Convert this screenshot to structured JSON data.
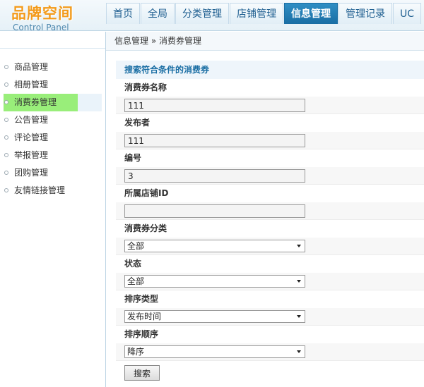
{
  "logo": {
    "title": "品牌空间",
    "subtitle": "Control Panel"
  },
  "nav": {
    "tabs": [
      {
        "label": "首页"
      },
      {
        "label": "全局"
      },
      {
        "label": "分类管理"
      },
      {
        "label": "店铺管理"
      },
      {
        "label": "信息管理",
        "active": true
      },
      {
        "label": "管理记录"
      },
      {
        "label": "UC"
      }
    ]
  },
  "sidebar": {
    "items": [
      {
        "label": "商品管理"
      },
      {
        "label": "相册管理"
      },
      {
        "label": "消费券管理",
        "active": true
      },
      {
        "label": "公告管理"
      },
      {
        "label": "评论管理"
      },
      {
        "label": "举报管理"
      },
      {
        "label": "团购管理"
      },
      {
        "label": "友情链接管理"
      }
    ]
  },
  "breadcrumb": {
    "parent": "信息管理",
    "separator": "»",
    "current": "消费券管理"
  },
  "search": {
    "title": "搜索符合条件的消费券",
    "fields": {
      "name": {
        "label": "消费券名称",
        "value": "111"
      },
      "publisher": {
        "label": "发布者",
        "value": "111"
      },
      "number": {
        "label": "编号",
        "value": "3"
      },
      "shop_id": {
        "label": "所属店铺ID",
        "value": ""
      },
      "category": {
        "label": "消费券分类",
        "selected": "全部"
      },
      "status": {
        "label": "状态",
        "selected": "全部"
      },
      "sort_type": {
        "label": "排序类型",
        "selected": "发布时间"
      },
      "sort_order": {
        "label": "排序顺序",
        "selected": "降序"
      }
    },
    "submit_label": "搜索"
  },
  "colors": {
    "accent": "#1a6ea4",
    "logo": "#f39a1a",
    "active_menu": "#99ee7a"
  }
}
